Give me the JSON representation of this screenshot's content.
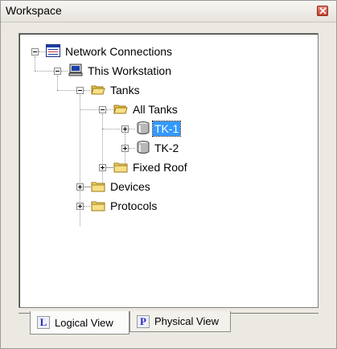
{
  "window": {
    "title": "Workspace",
    "close_icon": "close-icon"
  },
  "tree": {
    "items": [
      {
        "label": "Network Connections",
        "icon": "network-connections-icon",
        "expanded": true
      },
      {
        "label": "This Workstation",
        "icon": "computer-icon",
        "expanded": true
      },
      {
        "label": "Tanks",
        "icon": "folder-open-icon",
        "expanded": true
      },
      {
        "label": "All Tanks",
        "icon": "folder-open-icon",
        "expanded": true
      },
      {
        "label": "TK-1",
        "icon": "tank-icon",
        "expanded": false,
        "selected": true
      },
      {
        "label": "TK-2",
        "icon": "tank-icon",
        "expanded": false
      },
      {
        "label": "Fixed Roof",
        "icon": "folder-icon",
        "expanded": false
      },
      {
        "label": "Devices",
        "icon": "folder-icon",
        "expanded": false
      },
      {
        "label": "Protocols",
        "icon": "folder-icon",
        "expanded": false
      }
    ]
  },
  "tabs": [
    {
      "letter": "L",
      "label": "Logical View",
      "active": true
    },
    {
      "letter": "P",
      "label": "Physical View",
      "active": false
    }
  ],
  "colors": {
    "selection": "#3399ff",
    "folder": "#f2d66b",
    "tab_letter": "#2a2ab8"
  }
}
